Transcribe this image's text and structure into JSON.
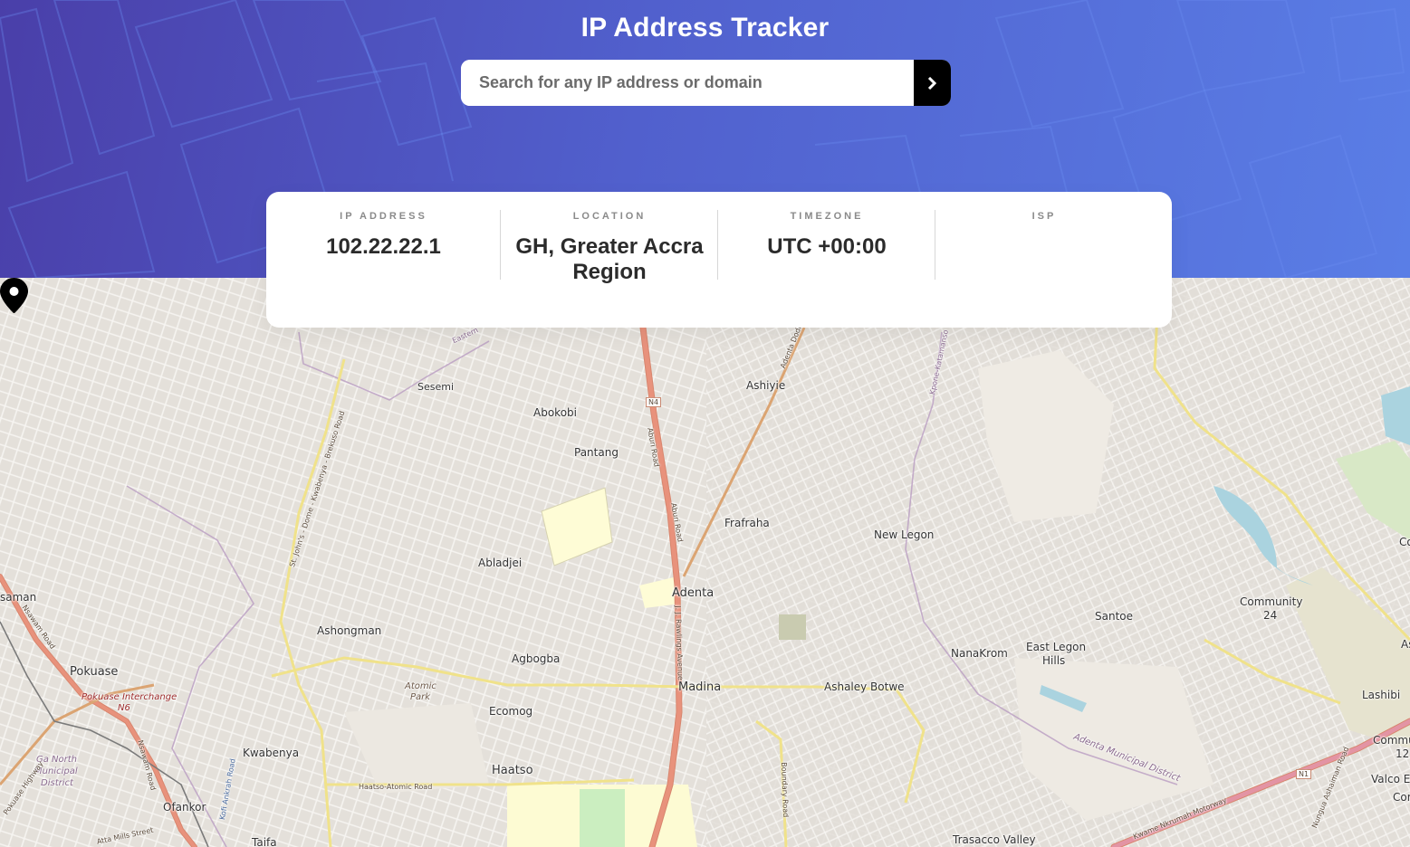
{
  "header": {
    "title": "IP Address Tracker",
    "search": {
      "placeholder": "Search for any IP address or domain",
      "value": ""
    },
    "submit_icon": "chevron-right-icon"
  },
  "info": {
    "ip_address": {
      "label": "IP ADDRESS",
      "value": "102.22.22.1"
    },
    "location": {
      "label": "LOCATION",
      "value": "GH, Greater Accra Region"
    },
    "timezone": {
      "label": "TIMEZONE",
      "value": "UTC +00:00"
    },
    "isp": {
      "label": "ISP",
      "value": ""
    }
  },
  "map": {
    "marker_icon": "location-pin-icon",
    "places": [
      "Sesemi",
      "Ashiyie",
      "Abokobi",
      "Pantang",
      "Frafraha",
      "New Legon",
      "Abladjei",
      "Adenta",
      "Ashongman",
      "Agbogba",
      "Madina",
      "Ashaley Botwe",
      "NanaKrom",
      "East Legon",
      "Hills",
      "Santoe",
      "Community",
      "24",
      "Lashibi",
      "Pokuase",
      "Kwabenya",
      "Haatso",
      "Ecomog",
      "Ofankor",
      "Taifa",
      "Trasacco Valley",
      "saman",
      "Co",
      "As",
      "Commu",
      "12",
      "Valco E",
      "Cor"
    ],
    "small_labels": [
      "Atomic",
      "Park",
      "Pokuase Interchange",
      "N6"
    ],
    "district_labels": [
      "Ga North",
      "Municipal",
      "District",
      "Adenta Municipal District"
    ],
    "road_labels": [
      "N4",
      "Aburi Road",
      "J. J. Rawlings Avenue",
      "Adenta Dodowa",
      "Kpone-Katamanso",
      "St. John's - Dome - Kwabenya - Brekuso Road",
      "Haatso-Atomic Road",
      "Boundary Road",
      "Nsawam Road",
      "Kwame Nkrumah Motorway",
      "N1",
      "Nungua Ashaiman Road",
      "Pokuase Highway",
      "Atta Mills Street",
      "Eastern",
      "Kofi Ankrah Road"
    ]
  },
  "colors": {
    "header_start": "#4a3fa9",
    "header_end": "#5a7ee6",
    "button": "#000000",
    "card_text": "#2b2b2b",
    "label_text": "#8a8a8a",
    "major_road": "#e8927c",
    "secondary_road": "#f7fabf"
  }
}
